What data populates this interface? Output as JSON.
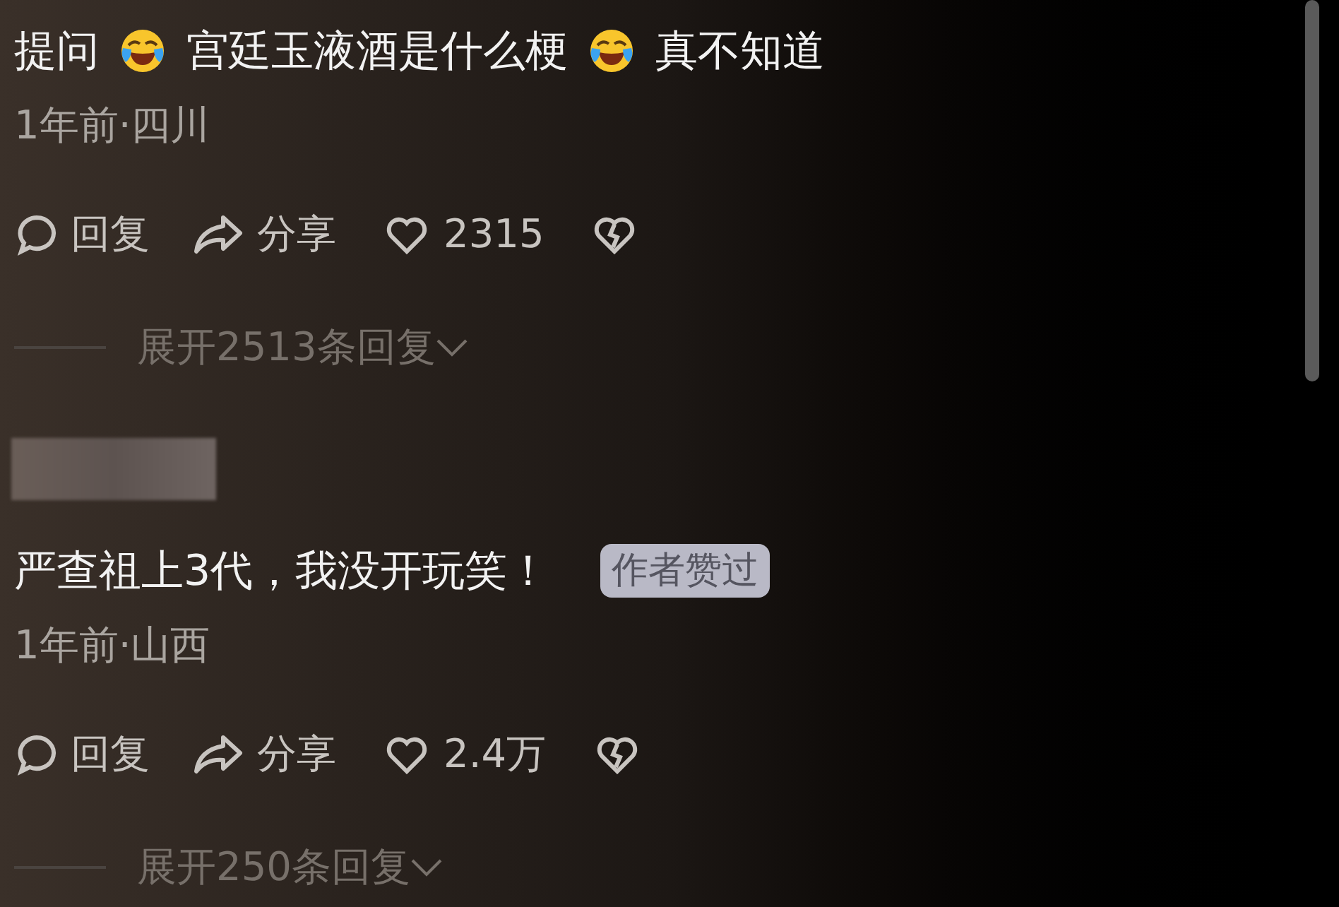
{
  "comments": [
    {
      "parts": [
        {
          "kind": "text",
          "text": "提问"
        },
        {
          "kind": "emoji"
        },
        {
          "kind": "text",
          "text": "宫廷玉液酒是什么梗"
        },
        {
          "kind": "emoji"
        },
        {
          "kind": "text",
          "text": "真不知道"
        }
      ],
      "meta": "1年前·四川",
      "reply": "回复",
      "share": "分享",
      "likes": "2315",
      "expand": "展开2513条回复"
    },
    {
      "author_blurred": true,
      "parts": [
        {
          "kind": "text",
          "text": "严查祖上3代，我没开玩笑！"
        }
      ],
      "badge": "作者赞过",
      "meta": "1年前·山西",
      "reply": "回复",
      "share": "分享",
      "likes": "2.4万",
      "expand": "展开250条回复"
    }
  ]
}
